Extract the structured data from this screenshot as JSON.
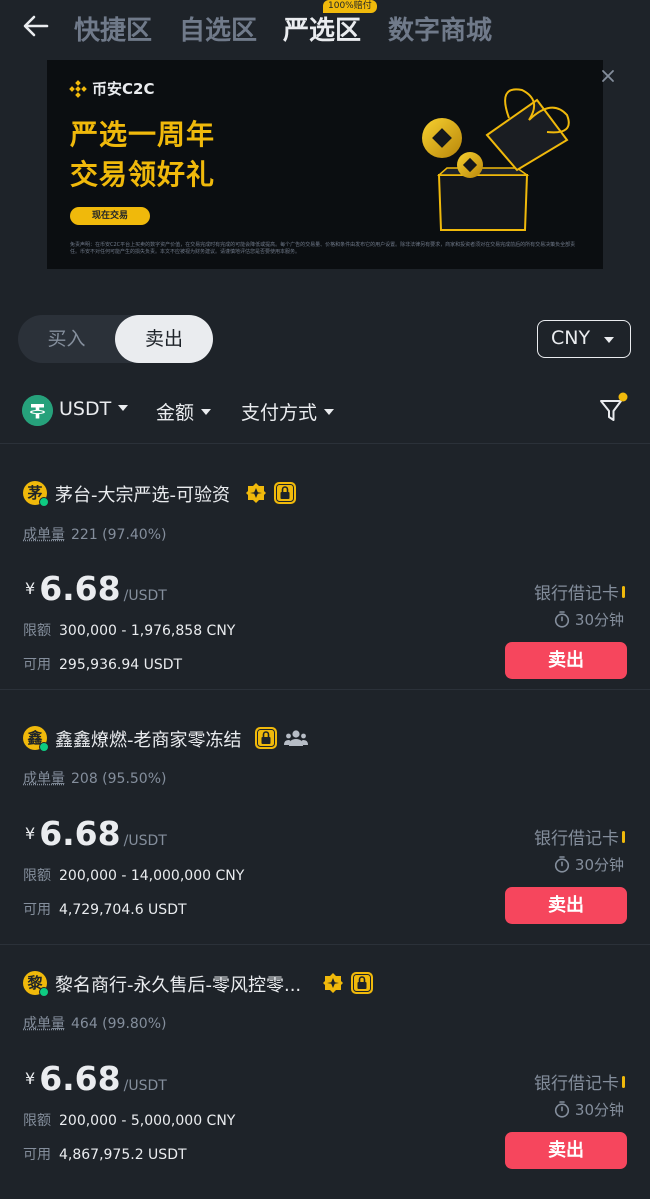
{
  "nav": {
    "tabs": [
      "快捷区",
      "自选区",
      "严选区",
      "数字商城"
    ],
    "active_tab": "严选区",
    "badge": "100%赔付"
  },
  "banner": {
    "brand": "币安C2C",
    "headline_1": "严选一周年",
    "headline_2": "交易领好礼",
    "cta": "现在交易",
    "disclaimer": "免责声明：在币安C2C平台上买卖的数字资产价值，在交易完成时有完成的可能会降低或提高。每个广告的交易量、价格和条件由发布它的用户设置。除非法律另有要求，商家和投资者须对在交易完成前后的所有交易决策负全部责任。币安不对任何可能产生的损失负责。本文不应被视为财务建议。请谨慎地评估您是否要使用本服务。"
  },
  "side_toggle": {
    "buy": "买入",
    "sell": "卖出",
    "selected": "卖出"
  },
  "currency": "CNY",
  "filters": {
    "asset": "USDT",
    "amount": "金额",
    "payment": "支付方式"
  },
  "ads": [
    {
      "avatar": "茅",
      "name": "茅台-大宗严选-可验资",
      "orders_label": "成单量",
      "orders": "221 (97.40%)",
      "currency_symbol": "¥",
      "price": "6.68",
      "unit": "/USDT",
      "limit_label": "限额",
      "limit": "300,000 - 1,976,858 CNY",
      "available_label": "可用",
      "available": "295,936.94 USDT",
      "payment": "银行借记卡",
      "time": "30分钟",
      "action": "卖出"
    },
    {
      "avatar": "鑫",
      "name": "鑫鑫燎燃-老商家零冻结",
      "orders_label": "成单量",
      "orders": "208 (95.50%)",
      "currency_symbol": "¥",
      "price": "6.68",
      "unit": "/USDT",
      "limit_label": "限额",
      "limit": "200,000 - 14,000,000 CNY",
      "available_label": "可用",
      "available": "4,729,704.6 USDT",
      "payment": "银行借记卡",
      "time": "30分钟",
      "action": "卖出"
    },
    {
      "avatar": "黎",
      "name": "黎名商行-永久售后-零风控零...",
      "orders_label": "成单量",
      "orders": "464 (99.80%)",
      "currency_symbol": "¥",
      "price": "6.68",
      "unit": "/USDT",
      "limit_label": "限额",
      "limit": "200,000 - 5,000,000 CNY",
      "available_label": "可用",
      "available": "4,867,975.2 USDT",
      "payment": "银行借记卡",
      "time": "30分钟",
      "action": "卖出"
    }
  ],
  "colors": {
    "background": "#1e2329",
    "accent": "#f0b90b",
    "sell": "#f6465d",
    "online": "#0ecb81",
    "usdt": "#26a17b"
  }
}
